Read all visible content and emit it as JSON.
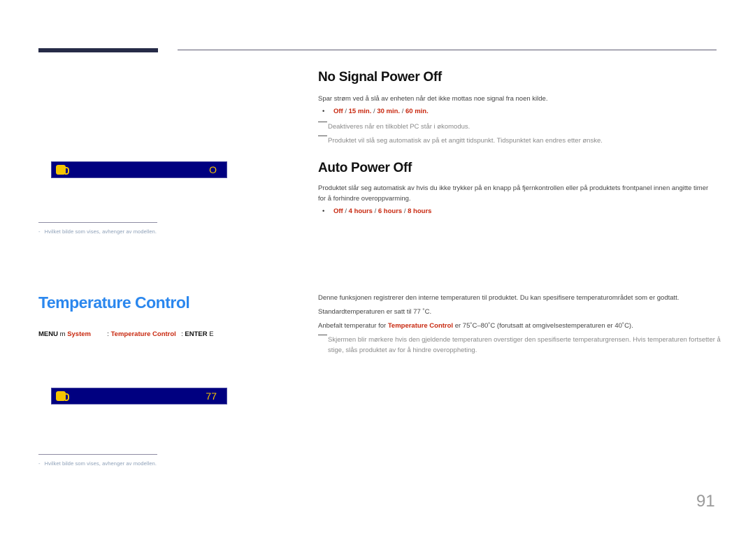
{
  "page": {
    "number": "91"
  },
  "left_column": {
    "osd_no_signal": {
      "icon": "power-plug-icon",
      "value": "O"
    },
    "footnote_1": {
      "dash": "-",
      "text": "Hvilket bilde som vises, avhenger av modellen."
    },
    "temperature_control": {
      "title": "Temperature Control",
      "menu_path": {
        "menu": "MENU",
        "menu_symbol": "m",
        "system": "System",
        "sep1": ":",
        "item": "Temperature Control",
        "sep2": ":",
        "enter": "ENTER",
        "enter_symbol": "E"
      }
    },
    "osd_temperature": {
      "icon": "thermometer-icon",
      "value": "77"
    },
    "footnote_2": {
      "dash": "-",
      "text": "Hvilket bilde som vises, avhenger av modellen."
    }
  },
  "no_signal_power_off": {
    "title": "No Signal Power Off",
    "description": "Spar strøm ved å slå av enheten når det ikke mottas noe signal fra noen kilde.",
    "options": [
      "Off",
      "15 min.",
      "30 min.",
      "60 min."
    ],
    "notes": [
      "Deaktiveres når en tilkoblet PC står i økomodus.",
      "Produktet vil slå seg automatisk av på et angitt tidspunkt. Tidspunktet kan endres etter ønske."
    ]
  },
  "auto_power_off": {
    "title": "Auto Power Off",
    "description": "Produktet slår seg automatisk av hvis du ikke trykker på en knapp på fjernkontrollen eller på produktets frontpanel innen angitte timer for å forhindre overoppvarming.",
    "options": [
      "Off",
      "4 hours",
      "6 hours",
      "8 hours"
    ]
  },
  "temperature_section": {
    "paragraph_1": "Denne funksjonen registrerer den interne temperaturen til produktet. Du kan spesifisere temperaturområdet som er godtatt.",
    "paragraph_2": "Standardtemperaturen er satt til 77 ˚C.",
    "paragraph_3_prefix": "Anbefalt temperatur for ",
    "paragraph_3_highlight": "Temperature Control",
    "paragraph_3_suffix": " er 75˚C–80˚C (forutsatt at omgivelsestemperaturen er 40˚C).",
    "note": "Skjermen blir mørkere hvis den gjeldende temperaturen overstiger den spesifiserte temperaturgrensen. Hvis temperaturen fortsetter å stige, slås produktet av for å hindre overoppheting."
  },
  "colors": {
    "accent_red": "#c8280f",
    "title_blue": "#2b87ee",
    "osd_background": "#000080",
    "osd_text": "#f5c400"
  }
}
